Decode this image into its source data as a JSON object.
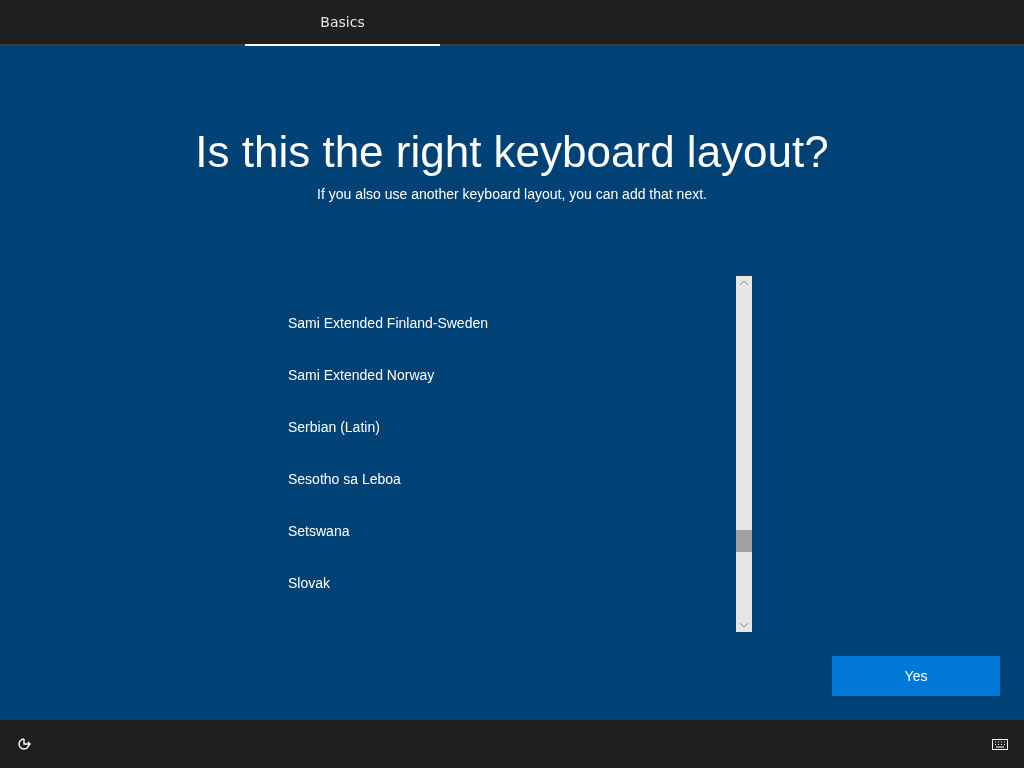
{
  "tabs": [
    {
      "label": "Basics",
      "selected": true
    }
  ],
  "title": "Is this the right keyboard layout?",
  "subtitle": "If you also use another keyboard layout, you can add that next.",
  "layouts": [
    {
      "label": "Sami Extended Finland-Sweden",
      "selected": false
    },
    {
      "label": "Sami Extended Norway",
      "selected": false
    },
    {
      "label": "Serbian (Latin)",
      "selected": false
    },
    {
      "label": "Sesotho sa Leboa",
      "selected": false
    },
    {
      "label": "Setswana",
      "selected": false
    },
    {
      "label": "Slovak",
      "selected": false
    }
  ],
  "buttons": [
    "Yes"
  ]
}
